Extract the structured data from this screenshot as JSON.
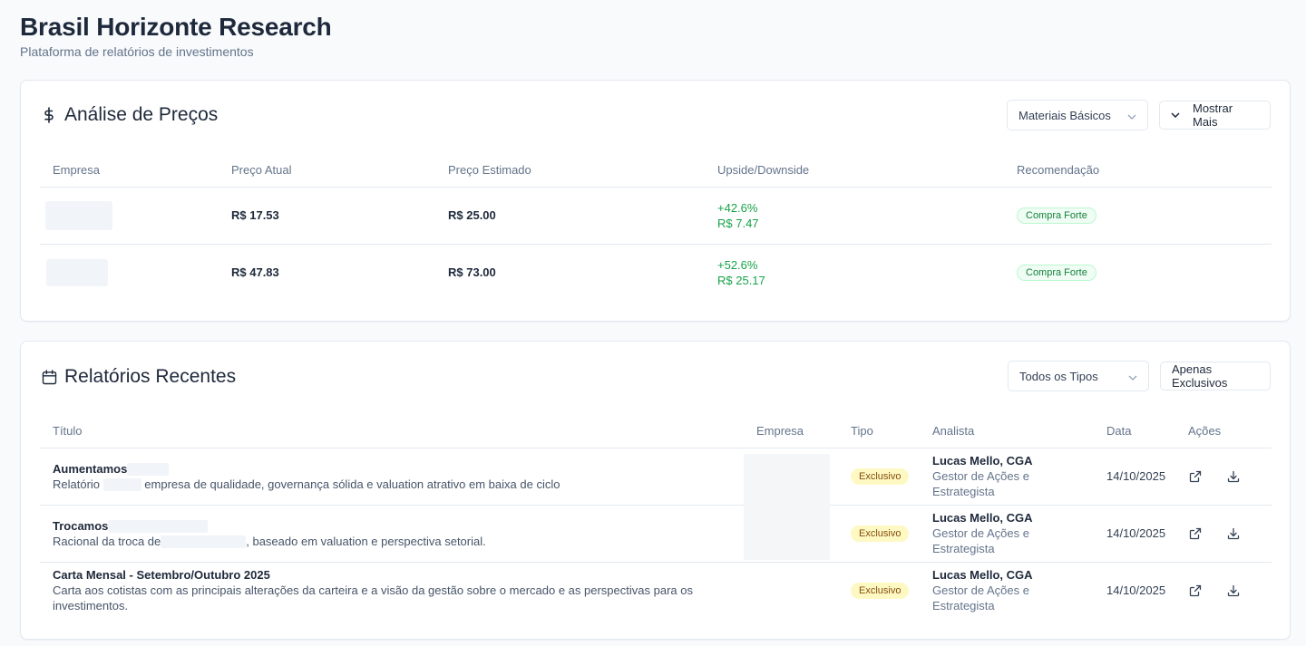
{
  "app": {
    "title": "Brasil Horizonte Research",
    "subtitle": "Plataforma de relatórios de investimentos"
  },
  "prices": {
    "title": "Análise de Preços",
    "icon": "dollar-icon",
    "sector_select": "Materiais Básicos",
    "show_more_label": "Mostrar Mais",
    "columns": [
      "Empresa",
      "Preço Atual",
      "Preço Estimado",
      "Upside/Downside",
      "Recomendação"
    ],
    "rows": [
      {
        "company": "",
        "current": "R$ 17.53",
        "target": "R$ 25.00",
        "upside_pct": "+42.6%",
        "upside_abs": "R$ 7.47",
        "recommendation": "Compra Forte"
      },
      {
        "company": "",
        "current": "R$ 47.83",
        "target": "R$ 73.00",
        "upside_pct": "+52.6%",
        "upside_abs": "R$ 25.17",
        "recommendation": "Compra Forte"
      }
    ]
  },
  "reports": {
    "title": "Relatórios Recentes",
    "icon": "calendar-icon",
    "type_select": "Todos os Tipos",
    "exclusive_label": "Apenas Exclusivos",
    "columns": [
      "Título",
      "Empresa",
      "Tipo",
      "Analista",
      "Data",
      "Ações"
    ],
    "rows": [
      {
        "title": "Aumentamos",
        "desc_before": "Relatório",
        "desc_after": "empresa de qualidade, governança sólida e valuation atrativo em baixa de ciclo",
        "type": "Exclusivo",
        "analyst": "Lucas Mello, CGA",
        "role": "Gestor de Ações e Estrategista",
        "date": "14/10/2025"
      },
      {
        "title": "Trocamos",
        "desc_before": "Racional da troca de",
        "desc_after": ", baseado em valuation e perspectiva setorial.",
        "type": "Exclusivo",
        "analyst": "Lucas Mello, CGA",
        "role": "Gestor de Ações e Estrategista",
        "date": "14/10/2025"
      },
      {
        "title": "Carta Mensal - Setembro/Outubro 2025",
        "desc_before": "Carta aos cotistas com as principais alterações da carteira e a visão da gestão sobre o mercado e as perspectivas para os investimentos.",
        "desc_after": "",
        "type": "Exclusivo",
        "analyst": "Lucas Mello, CGA",
        "role": "Gestor de Ações e Estrategista",
        "date": "14/10/2025"
      }
    ]
  },
  "colors": {
    "positive": "#16a34a",
    "badge_green_bg": "#f0fdf4",
    "badge_yellow_bg": "#fef9c3"
  }
}
